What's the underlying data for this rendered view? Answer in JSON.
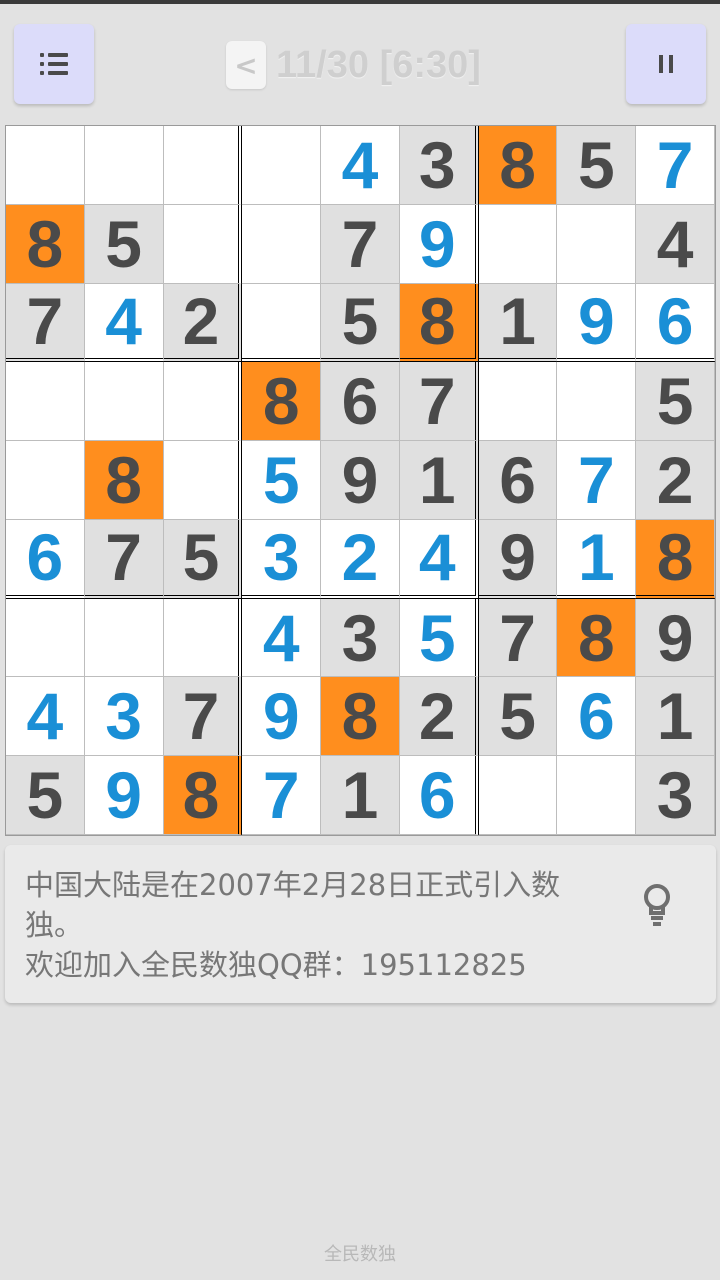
{
  "header": {
    "back_label": "<",
    "title": "11/30 [6:30]",
    "menu_icon": "list-menu-icon",
    "pause_icon": "pause-icon"
  },
  "colors": {
    "given": "#4a4a4a",
    "input": "#1a8fd6",
    "highlight": "#ff8e1e",
    "cell_white": "#ffffff",
    "cell_gray": "#e0e0e0"
  },
  "board": {
    "rows": [
      [
        {
          "v": "",
          "bg": "white",
          "k": ""
        },
        {
          "v": "",
          "bg": "white",
          "k": ""
        },
        {
          "v": "",
          "bg": "white",
          "k": ""
        },
        {
          "v": "",
          "bg": "white",
          "k": ""
        },
        {
          "v": "4",
          "bg": "white",
          "k": "input"
        },
        {
          "v": "3",
          "bg": "gray",
          "k": "given"
        },
        {
          "v": "8",
          "bg": "orange",
          "k": "given"
        },
        {
          "v": "5",
          "bg": "gray",
          "k": "given"
        },
        {
          "v": "7",
          "bg": "white",
          "k": "input"
        }
      ],
      [
        {
          "v": "8",
          "bg": "orange",
          "k": "given"
        },
        {
          "v": "5",
          "bg": "gray",
          "k": "given"
        },
        {
          "v": "",
          "bg": "white",
          "k": ""
        },
        {
          "v": "",
          "bg": "white",
          "k": ""
        },
        {
          "v": "7",
          "bg": "gray",
          "k": "given"
        },
        {
          "v": "9",
          "bg": "white",
          "k": "input"
        },
        {
          "v": "",
          "bg": "white",
          "k": ""
        },
        {
          "v": "",
          "bg": "white",
          "k": ""
        },
        {
          "v": "4",
          "bg": "gray",
          "k": "given"
        }
      ],
      [
        {
          "v": "7",
          "bg": "gray",
          "k": "given"
        },
        {
          "v": "4",
          "bg": "white",
          "k": "input"
        },
        {
          "v": "2",
          "bg": "gray",
          "k": "given"
        },
        {
          "v": "",
          "bg": "white",
          "k": ""
        },
        {
          "v": "5",
          "bg": "gray",
          "k": "given"
        },
        {
          "v": "8",
          "bg": "orange",
          "k": "given"
        },
        {
          "v": "1",
          "bg": "gray",
          "k": "given"
        },
        {
          "v": "9",
          "bg": "white",
          "k": "input"
        },
        {
          "v": "6",
          "bg": "white",
          "k": "input"
        }
      ],
      [
        {
          "v": "",
          "bg": "white",
          "k": ""
        },
        {
          "v": "",
          "bg": "white",
          "k": ""
        },
        {
          "v": "",
          "bg": "white",
          "k": ""
        },
        {
          "v": "8",
          "bg": "orange",
          "k": "given"
        },
        {
          "v": "6",
          "bg": "gray",
          "k": "given"
        },
        {
          "v": "7",
          "bg": "gray",
          "k": "given"
        },
        {
          "v": "",
          "bg": "white",
          "k": ""
        },
        {
          "v": "",
          "bg": "white",
          "k": ""
        },
        {
          "v": "5",
          "bg": "gray",
          "k": "given"
        }
      ],
      [
        {
          "v": "",
          "bg": "white",
          "k": ""
        },
        {
          "v": "8",
          "bg": "orange",
          "k": "given"
        },
        {
          "v": "",
          "bg": "white",
          "k": ""
        },
        {
          "v": "5",
          "bg": "white",
          "k": "input"
        },
        {
          "v": "9",
          "bg": "gray",
          "k": "given"
        },
        {
          "v": "1",
          "bg": "gray",
          "k": "given"
        },
        {
          "v": "6",
          "bg": "gray",
          "k": "given"
        },
        {
          "v": "7",
          "bg": "white",
          "k": "input"
        },
        {
          "v": "2",
          "bg": "gray",
          "k": "given"
        }
      ],
      [
        {
          "v": "6",
          "bg": "white",
          "k": "input"
        },
        {
          "v": "7",
          "bg": "gray",
          "k": "given"
        },
        {
          "v": "5",
          "bg": "gray",
          "k": "given"
        },
        {
          "v": "3",
          "bg": "white",
          "k": "input"
        },
        {
          "v": "2",
          "bg": "white",
          "k": "input"
        },
        {
          "v": "4",
          "bg": "white",
          "k": "input"
        },
        {
          "v": "9",
          "bg": "gray",
          "k": "given"
        },
        {
          "v": "1",
          "bg": "white",
          "k": "input"
        },
        {
          "v": "8",
          "bg": "orange",
          "k": "given"
        }
      ],
      [
        {
          "v": "",
          "bg": "white",
          "k": ""
        },
        {
          "v": "",
          "bg": "white",
          "k": ""
        },
        {
          "v": "",
          "bg": "white",
          "k": ""
        },
        {
          "v": "4",
          "bg": "white",
          "k": "input"
        },
        {
          "v": "3",
          "bg": "gray",
          "k": "given"
        },
        {
          "v": "5",
          "bg": "white",
          "k": "input"
        },
        {
          "v": "7",
          "bg": "gray",
          "k": "given"
        },
        {
          "v": "8",
          "bg": "orange",
          "k": "given"
        },
        {
          "v": "9",
          "bg": "gray",
          "k": "given"
        }
      ],
      [
        {
          "v": "4",
          "bg": "white",
          "k": "input"
        },
        {
          "v": "3",
          "bg": "white",
          "k": "input"
        },
        {
          "v": "7",
          "bg": "gray",
          "k": "given"
        },
        {
          "v": "9",
          "bg": "white",
          "k": "input"
        },
        {
          "v": "8",
          "bg": "orange",
          "k": "given"
        },
        {
          "v": "2",
          "bg": "gray",
          "k": "given"
        },
        {
          "v": "5",
          "bg": "gray",
          "k": "given"
        },
        {
          "v": "6",
          "bg": "white",
          "k": "input"
        },
        {
          "v": "1",
          "bg": "gray",
          "k": "given"
        }
      ],
      [
        {
          "v": "5",
          "bg": "gray",
          "k": "given"
        },
        {
          "v": "9",
          "bg": "white",
          "k": "input"
        },
        {
          "v": "8",
          "bg": "orange",
          "k": "given"
        },
        {
          "v": "7",
          "bg": "white",
          "k": "input"
        },
        {
          "v": "1",
          "bg": "gray",
          "k": "given"
        },
        {
          "v": "6",
          "bg": "white",
          "k": "input"
        },
        {
          "v": "",
          "bg": "white",
          "k": ""
        },
        {
          "v": "",
          "bg": "white",
          "k": ""
        },
        {
          "v": "3",
          "bg": "gray",
          "k": "given"
        }
      ]
    ]
  },
  "info": {
    "line1": "中国大陆是在2007年2月28日正式引入数独。",
    "line2": "欢迎加入全民数独QQ群：195112825",
    "hint_icon": "lightbulb-icon"
  },
  "footer": {
    "text": "全民数独"
  }
}
